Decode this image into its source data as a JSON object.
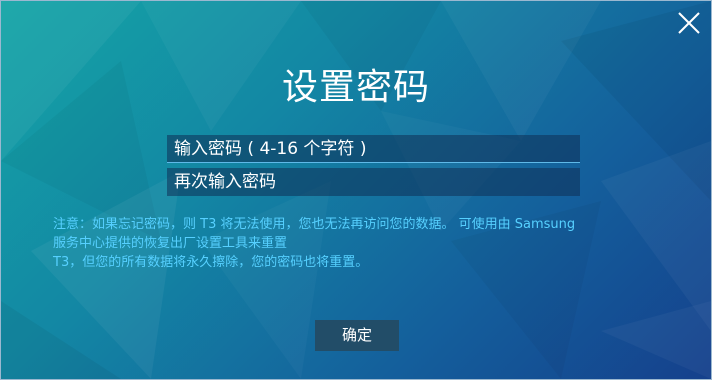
{
  "dialog": {
    "title": "设置密码",
    "close_icon": "close-icon",
    "password_placeholder": "输入密码 ( 4-16 个字符 )",
    "confirm_placeholder": "再次输入密码",
    "notice_lines": [
      "注意：如果忘记密码，则 T3 将无法使用，您也无法再访问您的数据。 可使用由 Samsung",
      "服务中心提供的恢复出厂设置工具来重置",
      "T3，但您的所有数据将永久擦除，您的密码也将重置。"
    ],
    "ok_label": "确定"
  },
  "colors": {
    "bg_start": "#14a5a6",
    "bg_end": "#15408c",
    "notice_text": "#56d0ff",
    "field_bg": "#0e3056",
    "field_underline": "#5fb9e8",
    "button_bg": "#224d68"
  }
}
